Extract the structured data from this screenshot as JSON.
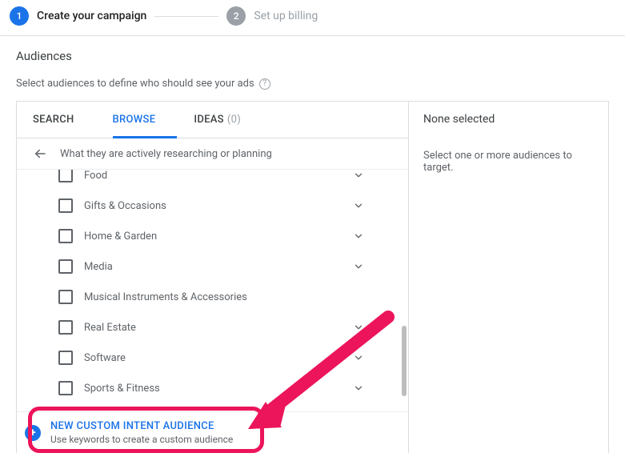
{
  "wizard": {
    "step1": {
      "num": "1",
      "label": "Create your campaign"
    },
    "step2": {
      "num": "2",
      "label": "Set up billing"
    }
  },
  "section": {
    "title": "Audiences",
    "subtitle": "Select audiences to define who should see your ads"
  },
  "tabs": {
    "search": "SEARCH",
    "browse": "BROWSE",
    "ideas": "IDEAS",
    "ideas_count": "(0)"
  },
  "breadcrumb": "What they are actively researching or planning",
  "categories": [
    {
      "label": "Food",
      "expandable": true
    },
    {
      "label": "Gifts & Occasions",
      "expandable": true
    },
    {
      "label": "Home & Garden",
      "expandable": true
    },
    {
      "label": "Media",
      "expandable": true
    },
    {
      "label": "Musical Instruments & Accessories",
      "expandable": false
    },
    {
      "label": "Real Estate",
      "expandable": true
    },
    {
      "label": "Software",
      "expandable": true
    },
    {
      "label": "Sports & Fitness",
      "expandable": true
    }
  ],
  "cta": {
    "title": "NEW CUSTOM INTENT AUDIENCE",
    "subtitle": "Use keywords to create a custom audience"
  },
  "right": {
    "title": "None selected",
    "subtitle": "Select one or more audiences to target."
  }
}
